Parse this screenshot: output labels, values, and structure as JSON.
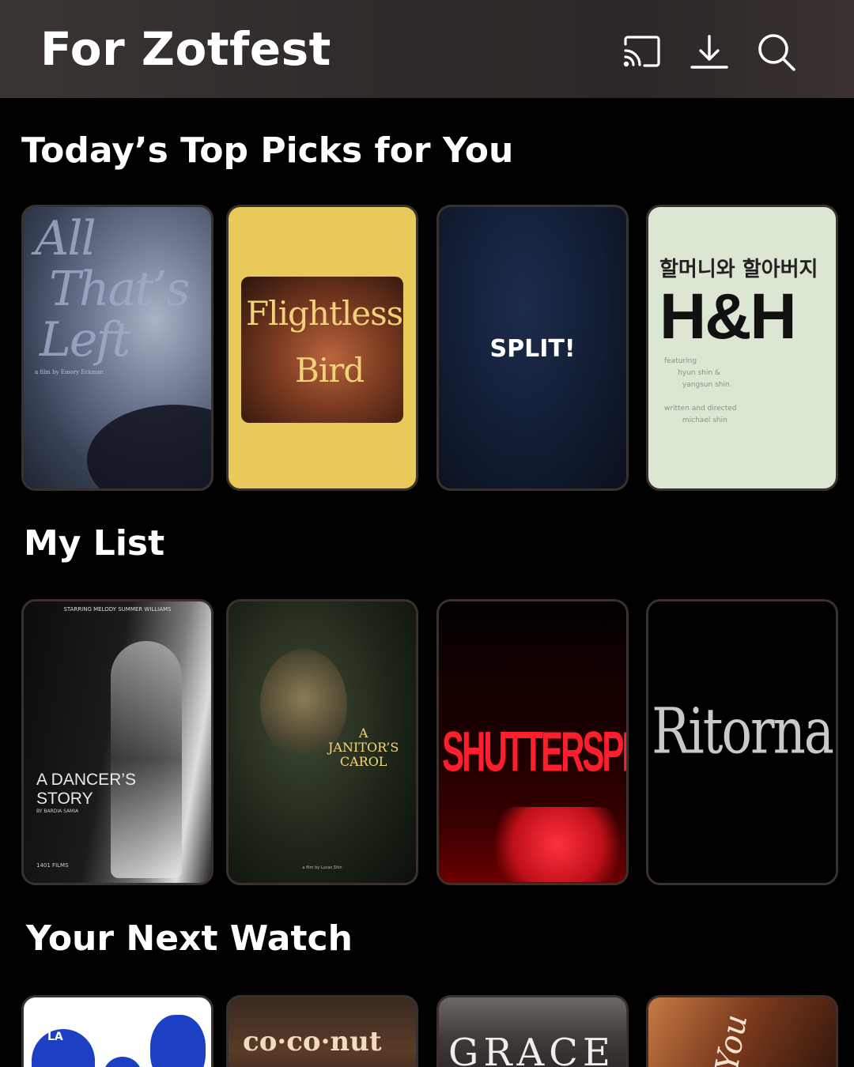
{
  "header": {
    "title": "For Zotfest",
    "icons": [
      "cast-icon",
      "download-icon",
      "search-icon"
    ]
  },
  "sections": [
    {
      "title": "Today’s Top Picks for You",
      "posters": [
        {
          "title_lines": [
            "All",
            "That’s",
            "Left"
          ],
          "credit": "a film by Emory Eckman"
        },
        {
          "title_line1": "Flightless",
          "title_line2": "Bird"
        },
        {
          "title": "SPLIT!"
        },
        {
          "korean": "할머니와 할아버지",
          "title": "H&H",
          "credits": "featuring\n      hyun shin &\n        yangsun shin\n\nwritten and directed\n        michael shin"
        }
      ]
    },
    {
      "title": "My List",
      "posters": [
        {
          "starring": "STARRING MELODY SUMMER WILLIAMS",
          "title": "A DANCER’S\nSTORY",
          "by": "BY BARDIA SAMIA",
          "logo": "1401 FILMS"
        },
        {
          "title": "A\nJANITOR’S\nCAROL",
          "footer": "a film by Lucas Shin"
        },
        {
          "title": "SHUTTERSPEED"
        },
        {
          "title": "Ritorna"
        }
      ]
    },
    {
      "title": "Your Next Watch",
      "posters": [
        {
          "cap": "LA"
        },
        {
          "title": "co·co·nut"
        },
        {
          "title": "GRACE"
        },
        {
          "title": "n'You"
        }
      ]
    }
  ],
  "colors": {
    "background": "#000000",
    "header_bg": "#2f2b2a",
    "poster_border": "#3a302c",
    "text": "#ffffff"
  }
}
